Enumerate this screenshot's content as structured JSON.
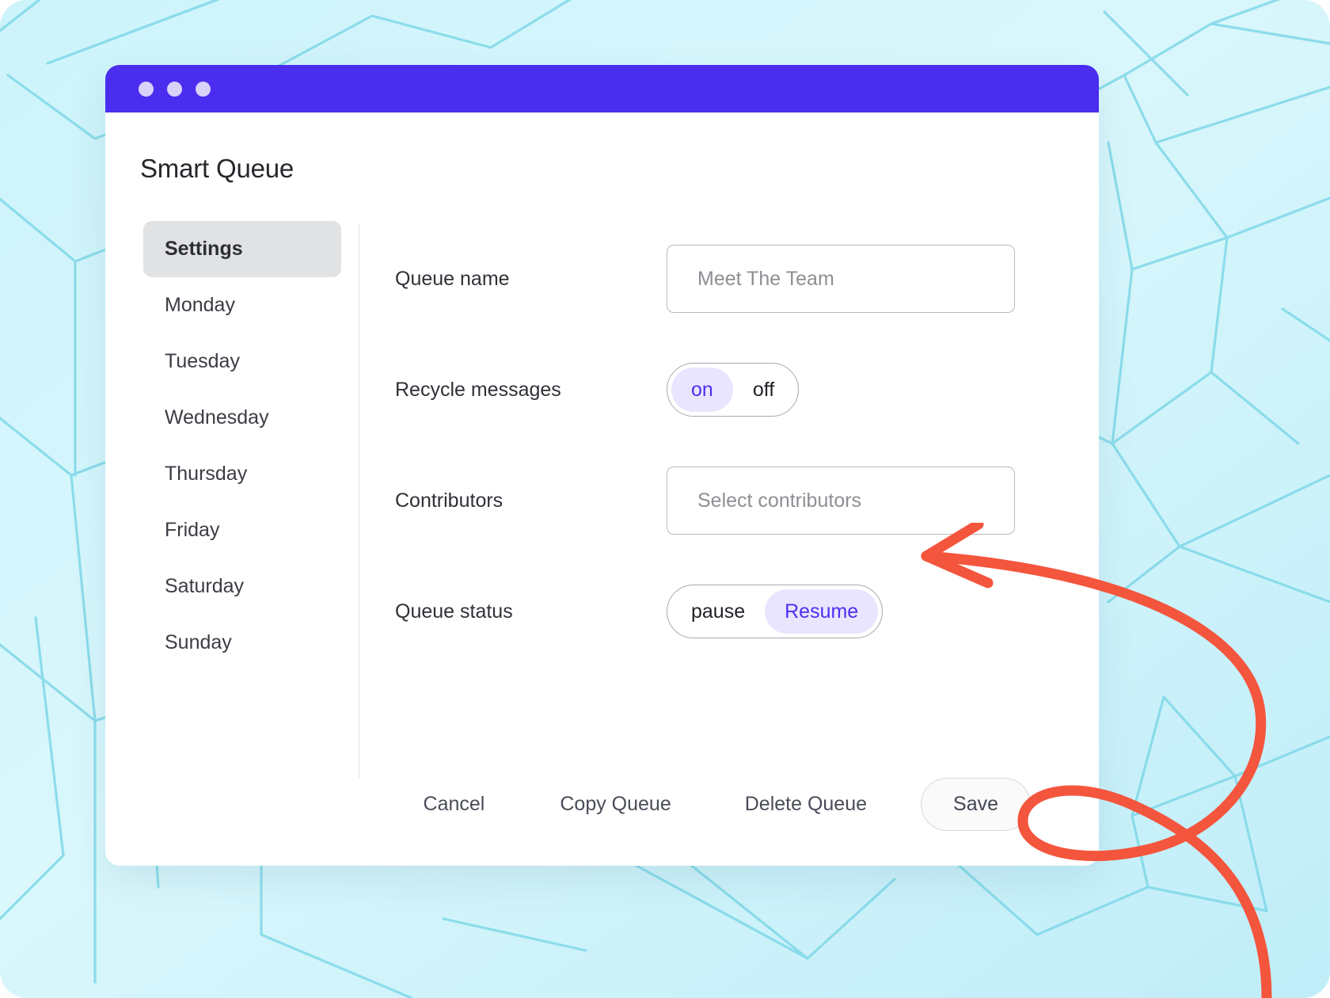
{
  "window": {
    "title_bar": {
      "dots": [
        "window-dot-1",
        "window-dot-2",
        "window-dot-3"
      ],
      "color": "#4a2dee"
    },
    "page_title": "Smart Queue"
  },
  "sidebar": {
    "items": [
      {
        "label": "Settings",
        "active": true
      },
      {
        "label": "Monday",
        "active": false
      },
      {
        "label": "Tuesday",
        "active": false
      },
      {
        "label": "Wednesday",
        "active": false
      },
      {
        "label": "Thursday",
        "active": false
      },
      {
        "label": "Friday",
        "active": false
      },
      {
        "label": "Saturday",
        "active": false
      },
      {
        "label": "Sunday",
        "active": false
      }
    ]
  },
  "form": {
    "queue_name": {
      "label": "Queue name",
      "placeholder": "Meet The Team",
      "value": "Meet The Team"
    },
    "recycle_messages": {
      "label": "Recycle messages",
      "options": [
        "on",
        "off"
      ],
      "selected": "on"
    },
    "contributors": {
      "label": "Contributors",
      "placeholder": "Select contributors",
      "value": "Select contributors"
    },
    "queue_status": {
      "label": "Queue status",
      "options": [
        "pause",
        "Resume"
      ],
      "selected": "Resume"
    }
  },
  "footer": {
    "cancel_label": "Cancel",
    "copy_label": "Copy Queue",
    "delete_label": "Delete Queue",
    "save_label": "Save"
  },
  "annotation": {
    "name": "red-curved-arrow",
    "color": "#f4553d",
    "points_to": "Resume"
  },
  "colors": {
    "accent": "#4a2dee",
    "toggle_selected_bg": "#e9e5ff",
    "toggle_selected_text": "#4f2df0",
    "background": "#c9f2fa",
    "pattern_line": "#7fd8e8",
    "annotation_red": "#f4553d"
  }
}
